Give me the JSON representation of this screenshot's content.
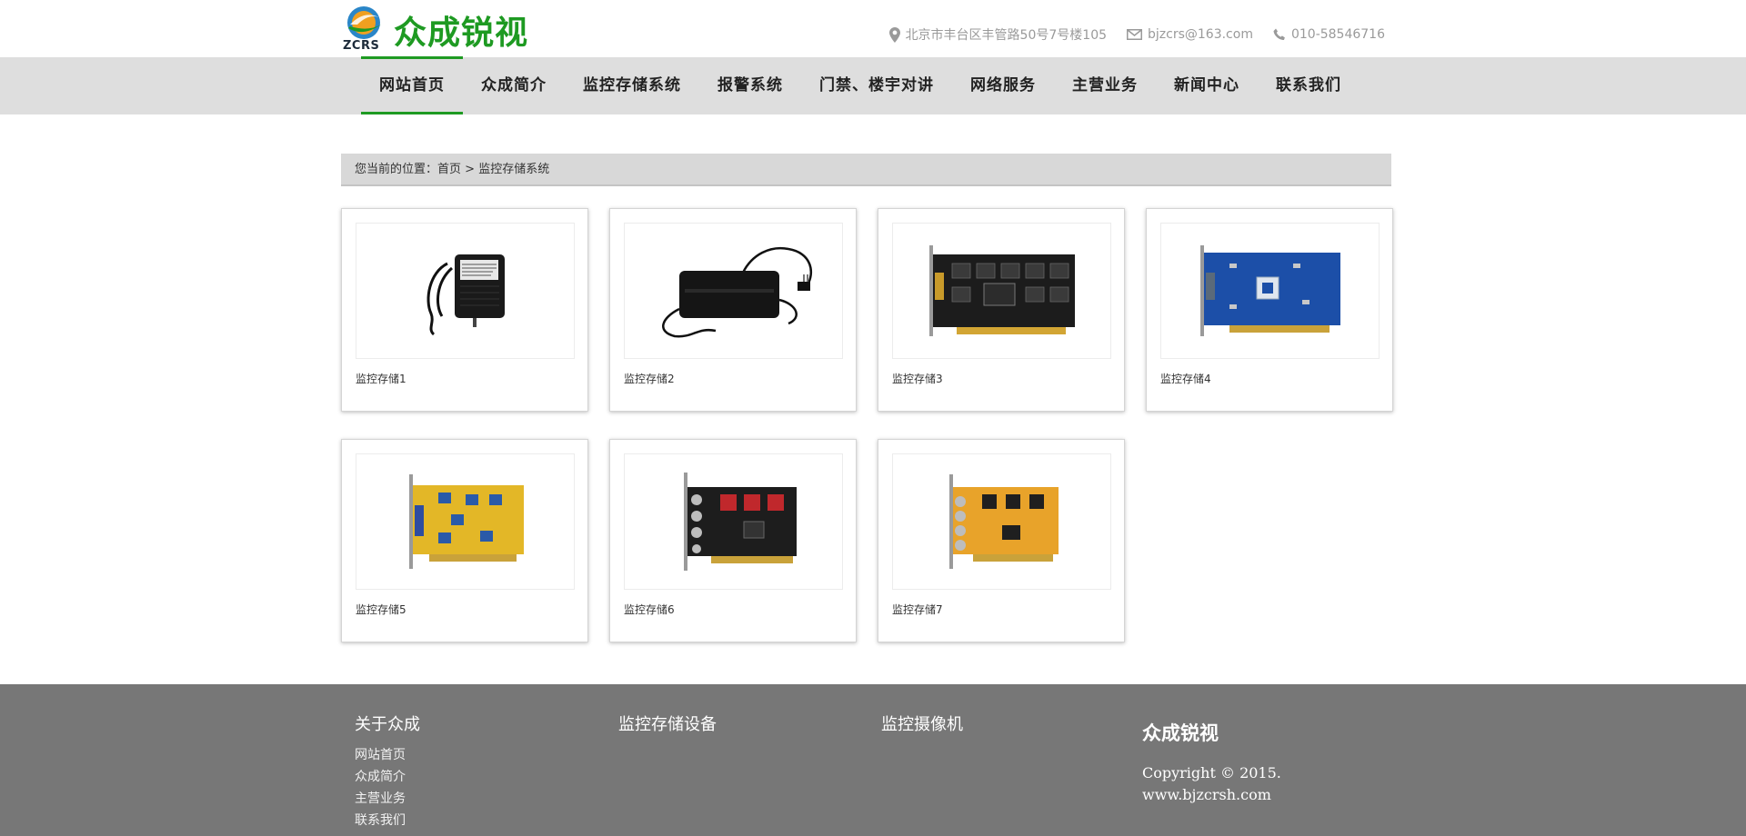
{
  "header": {
    "logo_abbr": "ZCRS",
    "logo_name": "众成锐视",
    "address": "北京市丰台区丰管路50号7号楼105",
    "email": "bjzcrs@163.com",
    "phone": "010-58546716"
  },
  "nav": {
    "items": [
      {
        "label": "网站首页"
      },
      {
        "label": "众成简介"
      },
      {
        "label": "监控存储系统"
      },
      {
        "label": "报警系统"
      },
      {
        "label": "门禁、楼宇对讲"
      },
      {
        "label": "网络服务"
      },
      {
        "label": "主营业务"
      },
      {
        "label": "新闻中心"
      },
      {
        "label": "联系我们"
      }
    ],
    "active_index": 0
  },
  "breadcrumb": {
    "prefix": "您当前的位置：",
    "home": "首页",
    "separator": " > ",
    "current": "监控存储系统"
  },
  "products": [
    {
      "title": "监控存储1",
      "image": "power-adapter"
    },
    {
      "title": "监控存储2",
      "image": "power-supply-box"
    },
    {
      "title": "监控存储3",
      "image": "capture-card-black"
    },
    {
      "title": "监控存储4",
      "image": "capture-card-blue"
    },
    {
      "title": "监控存储5",
      "image": "capture-card-yellow"
    },
    {
      "title": "监控存储6",
      "image": "capture-card-black-bnc"
    },
    {
      "title": "监控存储7",
      "image": "capture-card-orange-bnc"
    }
  ],
  "footer": {
    "col1_title": "关于众成",
    "col1_links": [
      "网站首页",
      "众成简介",
      "主营业务",
      "联系我们"
    ],
    "col2_title": "监控存储设备",
    "col3_title": "监控摄像机",
    "brand": "众成锐视",
    "copyright": "Copyright © 2015.",
    "website": "www.bjzcrsh.com"
  },
  "colors": {
    "accent_green": "#1e9a22",
    "nav_bg": "#dedede",
    "footer_bg": "#777777"
  }
}
